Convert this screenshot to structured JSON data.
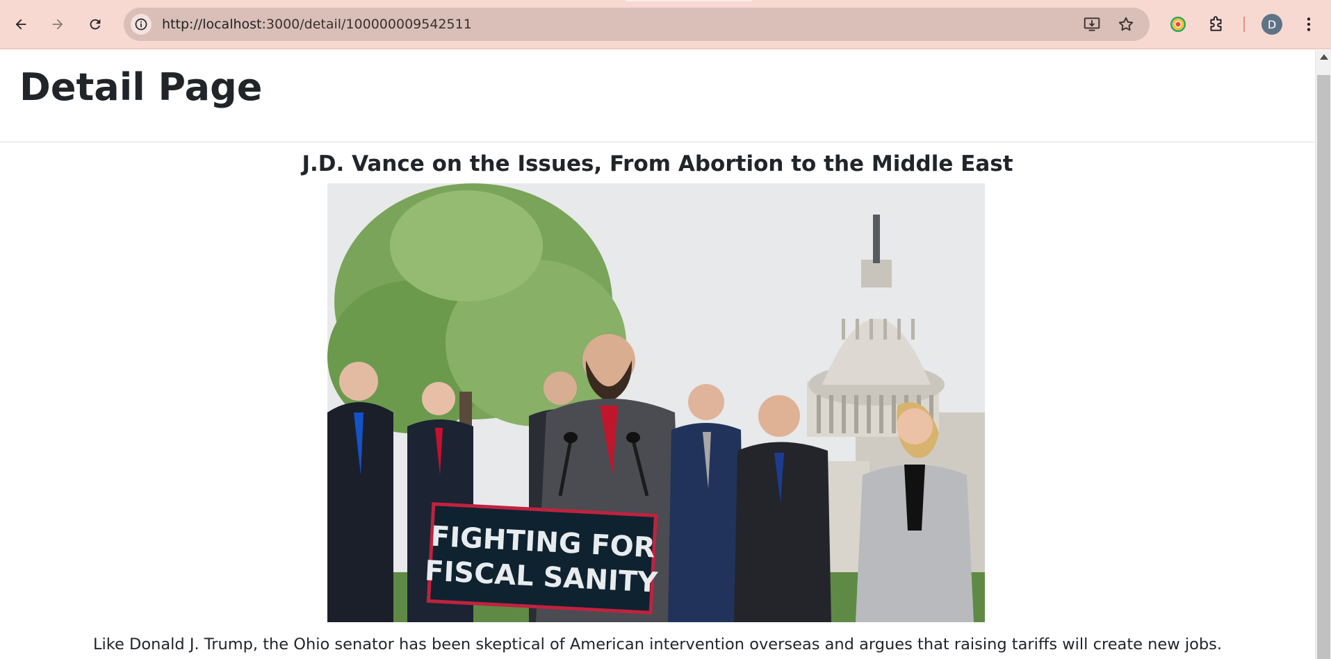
{
  "browser": {
    "url_host": "http://localhost",
    "url_rest": ":3000/detail/100000009542511",
    "profile_initial": "D"
  },
  "page": {
    "title": "Detail Page"
  },
  "article": {
    "headline": "J.D. Vance on the Issues, From Abortion to the Middle East",
    "caption": "Like Donald J. Trump, the Ohio senator has been skeptical of American intervention overseas and argues that raising tariffs will create new jobs.",
    "photo_sign_text_line1": "FIGHTING FOR",
    "photo_sign_text_line2": "FISCAL SANITY"
  },
  "colors": {
    "chrome_bg": "#f7d9d2",
    "omnibox_bg": "#d9bfb8",
    "text": "#212529",
    "sign_bg": "#0f2230",
    "sign_border": "#c0223f"
  },
  "icons": [
    "back-arrow-icon",
    "forward-arrow-icon",
    "reload-icon",
    "site-info-icon",
    "install-app-icon",
    "bookmark-star-icon",
    "extension-rainbow-icon",
    "puzzle-extensions-icon",
    "profile-avatar",
    "kebab-menu-icon"
  ]
}
